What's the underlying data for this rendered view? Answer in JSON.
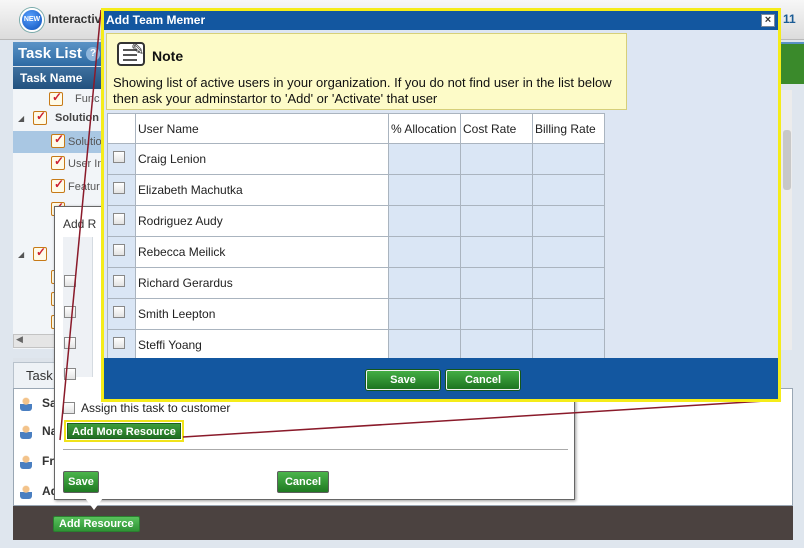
{
  "app": {
    "new_badge": "NEW",
    "top_title": "Interactiv",
    "top_number": "11"
  },
  "task_list": {
    "title": "Task List",
    "column_header": "Task Name",
    "rows": [
      {
        "label": "Func"
      },
      {
        "label": "Solution"
      },
      {
        "label": "Solutio"
      },
      {
        "label": "User In"
      },
      {
        "label": "Featur"
      }
    ]
  },
  "lower_tabs": {
    "task_tab": "Task"
  },
  "people": [
    {
      "label": "Sa"
    },
    {
      "label": "Na"
    },
    {
      "label": "Fr"
    },
    {
      "label": "Ad"
    }
  ],
  "footer": {
    "add_resource": "Add Resource"
  },
  "add_resource_panel": {
    "title": "Add R",
    "assign_label": "Assign this task to customer",
    "add_more": "Add More Resource",
    "save": "Save",
    "cancel": "Cancel"
  },
  "dialog": {
    "title": "Add Team Memer",
    "close": "×",
    "note_title": "Note",
    "note_text": "Showing list of active users in your organization. If you do not find user in the list below then ask your adminstartor to 'Add' or 'Activate' that user",
    "columns": [
      "User Name",
      "% Allocation",
      "Cost Rate",
      "Billing Rate"
    ],
    "users": [
      {
        "name": "Craig Lenion"
      },
      {
        "name": "Elizabeth Machutka"
      },
      {
        "name": "Rodriguez Audy"
      },
      {
        "name": "Rebecca Meilick"
      },
      {
        "name": "Richard Gerardus"
      },
      {
        "name": "Smith Leepton"
      },
      {
        "name": "Steffi Yoang"
      }
    ],
    "save": "Save",
    "cancel": "Cancel"
  },
  "colors": {
    "dialog_blue": "#1357a0",
    "highlight_yellow": "#f5ec19",
    "button_green": "#2f9335",
    "connector": "#8a1a2a"
  }
}
